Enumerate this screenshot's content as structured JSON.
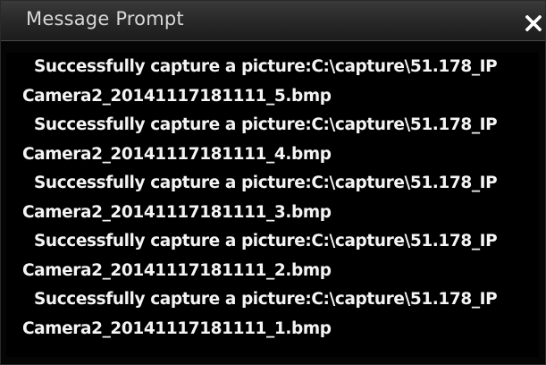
{
  "window": {
    "title": "Message Prompt",
    "close_icon": "close-icon"
  },
  "messages": [
    {
      "line1": "Successfully capture a picture:C:\\capture\\51.178_IP",
      "line2": "Camera2_20141117181111_5.bmp"
    },
    {
      "line1": "Successfully capture a picture:C:\\capture\\51.178_IP",
      "line2": "Camera2_20141117181111_4.bmp"
    },
    {
      "line1": "Successfully capture a picture:C:\\capture\\51.178_IP",
      "line2": "Camera2_20141117181111_3.bmp"
    },
    {
      "line1": "Successfully capture a picture:C:\\capture\\51.178_IP",
      "line2": "Camera2_20141117181111_2.bmp"
    },
    {
      "line1": "Successfully capture a picture:C:\\capture\\51.178_IP",
      "line2": "Camera2_20141117181111_1.bmp"
    }
  ],
  "colors": {
    "background": "#000000",
    "text": "#f4f4f4",
    "title_text": "#d8d8d8"
  }
}
